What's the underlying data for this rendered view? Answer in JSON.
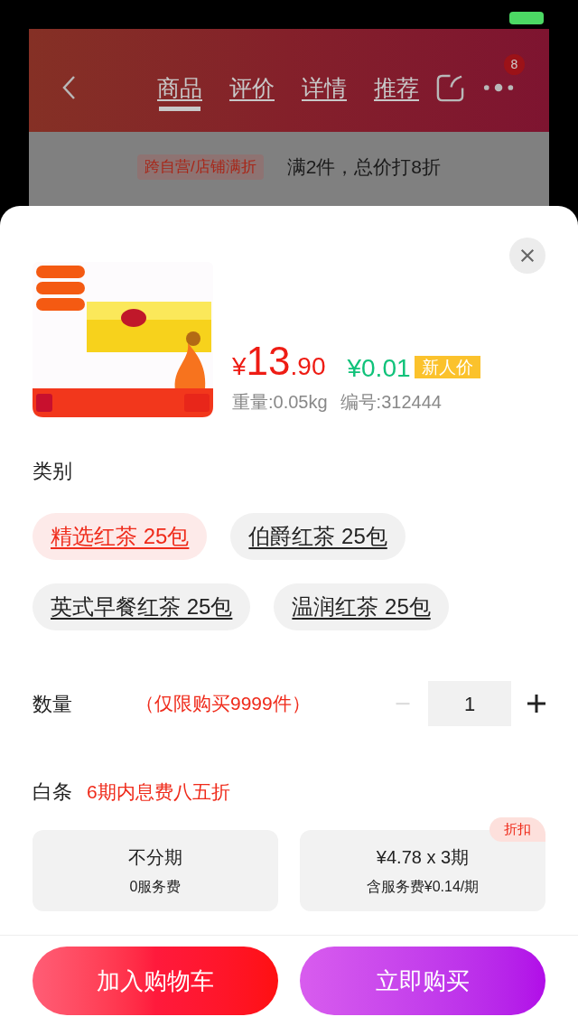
{
  "background_page": {
    "nav_tabs": [
      {
        "label": "商品",
        "selected": true
      },
      {
        "label": "评价",
        "selected": false
      },
      {
        "label": "详情",
        "selected": false
      },
      {
        "label": "推荐",
        "selected": false
      }
    ],
    "more_badge": "8",
    "promo": {
      "tag": "跨自营/店铺满折",
      "text": "满2件，总价打8折"
    }
  },
  "sheet": {
    "product": {
      "price_symbol": "¥",
      "price_integer": "13",
      "price_decimal": ".90",
      "new_user_price": "¥0.01",
      "new_user_tag": "新人价",
      "weight": "重量:0.05kg",
      "code": "编号:312444"
    },
    "category": {
      "title": "类别",
      "options": [
        {
          "label": "精选红茶 25包",
          "selected": true
        },
        {
          "label": "伯爵红茶 25包",
          "selected": false
        },
        {
          "label": "英式早餐红茶 25包",
          "selected": false
        },
        {
          "label": "温润红茶 25包",
          "selected": false
        }
      ]
    },
    "quantity": {
      "title": "数量",
      "limit": "（仅限购买9999件）",
      "value": "1",
      "decrement_disabled": true
    },
    "baitiao": {
      "title": "白条",
      "promo": "6期内息费八五折",
      "plans": [
        {
          "title": "不分期",
          "subtitle": "0服务费"
        },
        {
          "title": "¥4.78 x 3期",
          "subtitle": "含服务费¥0.14/期",
          "tag": "折扣"
        }
      ]
    },
    "buttons": [
      {
        "label": "加入购物车",
        "kind": "cart"
      },
      {
        "label": "立即购买",
        "kind": "buy"
      }
    ]
  }
}
